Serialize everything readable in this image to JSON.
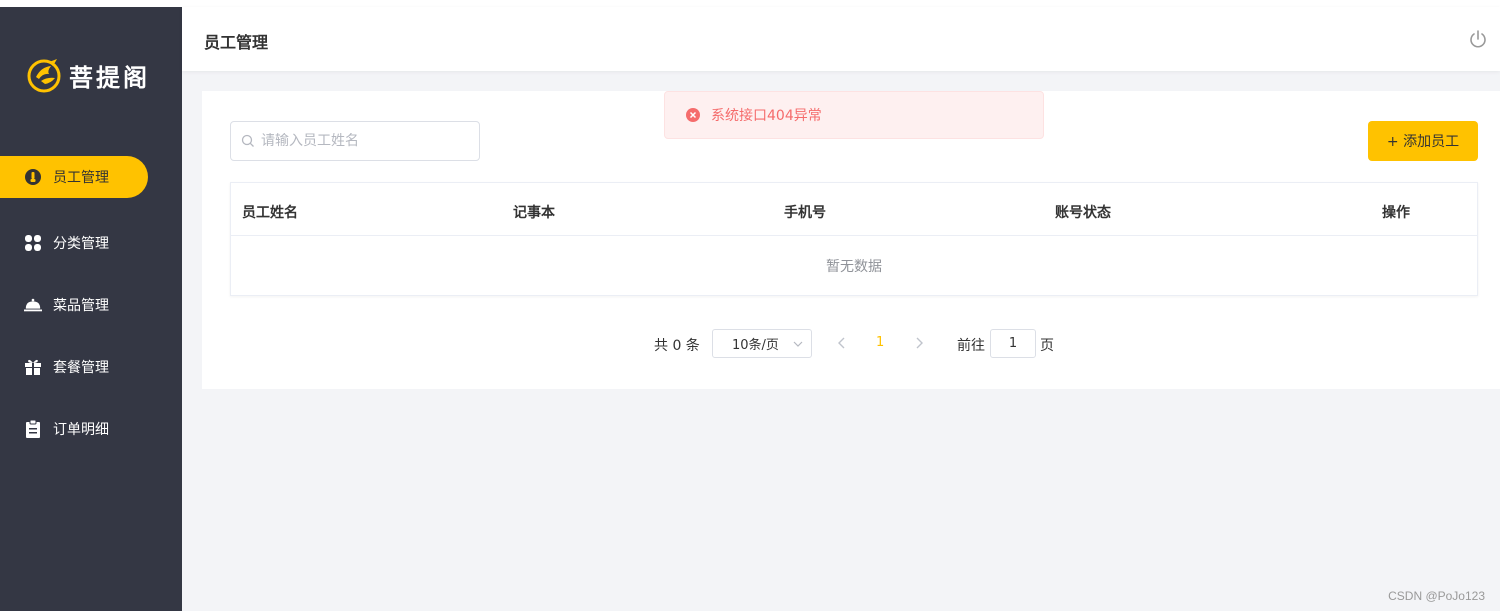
{
  "brand": {
    "name": "菩提阁",
    "accent": "#ffc200",
    "sidebar_bg": "#343744"
  },
  "sidebar": {
    "items": [
      {
        "label": "员工管理",
        "icon": "employee-icon",
        "active": true
      },
      {
        "label": "分类管理",
        "icon": "category-icon",
        "active": false
      },
      {
        "label": "菜品管理",
        "icon": "dish-icon",
        "active": false
      },
      {
        "label": "套餐管理",
        "icon": "setmeal-icon",
        "active": false
      },
      {
        "label": "订单明细",
        "icon": "order-icon",
        "active": false
      }
    ]
  },
  "header": {
    "title": "员工管理",
    "logout_icon": "power-icon"
  },
  "alert": {
    "type": "error",
    "message": "系统接口404异常",
    "color": "#f56c6c"
  },
  "toolbar": {
    "search_placeholder": "请输入员工姓名",
    "search_value": "",
    "add_label": "+ 添加员工"
  },
  "table": {
    "columns": [
      "员工姓名",
      "记事本",
      "手机号",
      "账号状态",
      "操作"
    ],
    "rows": [],
    "empty_text": "暂无数据"
  },
  "pagination": {
    "total_text": "共 0 条",
    "page_size": "10条/页",
    "current_page": "1",
    "goto_label": "前往",
    "goto_value": "1",
    "page_suffix": "页"
  },
  "watermark": "CSDN @PoJo123"
}
